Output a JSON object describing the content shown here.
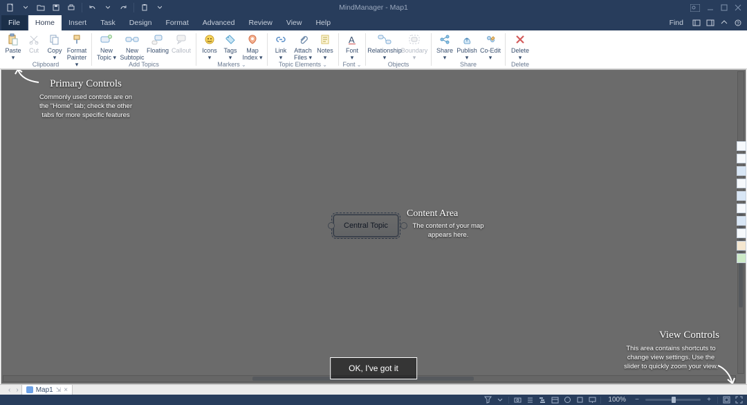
{
  "app": {
    "title": "MindManager - Map1"
  },
  "tabs": {
    "file": "File",
    "list": [
      "Home",
      "Insert",
      "Task",
      "Design",
      "Format",
      "Advanced",
      "Review",
      "View",
      "Help"
    ],
    "activeIndex": 0,
    "find": "Find"
  },
  "ribbon": {
    "groups": {
      "clipboard": {
        "label": "Clipboard",
        "paste": "Paste\n▾",
        "cut": "Cut",
        "copy": "Copy\n▾",
        "formatPainter": "Format\nPainter ▾"
      },
      "addTopics": {
        "label": "Add Topics",
        "newTopic": "New\nTopic ▾",
        "newSubtopic": "New\nSubtopic",
        "floating": "Floating",
        "callout": "Callout"
      },
      "markers": {
        "label": "Markers",
        "icons": "Icons\n▾",
        "tags": "Tags\n▾",
        "mapIndex": "Map\nIndex ▾"
      },
      "topicElements": {
        "label": "Topic Elements",
        "link": "Link\n▾",
        "attachFiles": "Attach\nFiles ▾",
        "notes": "Notes\n▾"
      },
      "font": {
        "label": "Font",
        "font": "Font\n▾"
      },
      "objects": {
        "label": "Objects",
        "relationship": "Relationship\n▾",
        "boundary": "Boundary\n▾"
      },
      "share": {
        "label": "Share",
        "share": "Share\n▾",
        "publish": "Publish\n▾",
        "coedit": "Co-Edit\n▾"
      },
      "delete": {
        "label": "Delete",
        "delete": "Delete\n▾"
      }
    }
  },
  "canvas": {
    "centralTopic": "Central Topic"
  },
  "tour": {
    "primary": {
      "title": "Primary Controls",
      "body": "Commonly used controls are on the \"Home\" tab; check the other tabs for more specific features"
    },
    "content": {
      "title": "Content Area",
      "body": "The content of your map appears here."
    },
    "view": {
      "title": "View Controls",
      "body": "This area contains shortcuts to change view settings. Use the slider to quickly zoom your view."
    },
    "ok": "OK, I've got it"
  },
  "docTabs": {
    "name": "Map1"
  },
  "status": {
    "zoom": "100%"
  },
  "colors": {
    "accent": "#283d5c"
  }
}
